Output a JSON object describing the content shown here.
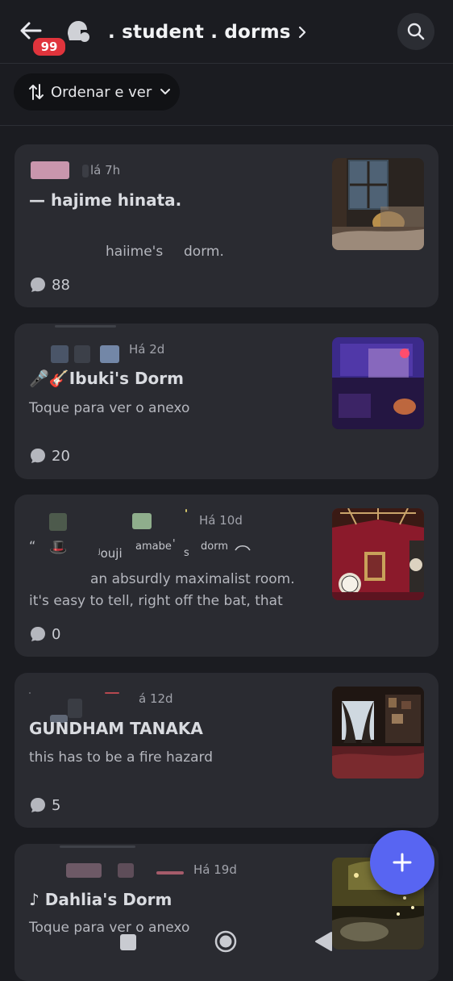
{
  "header": {
    "badge_count": "99",
    "title": ". student . dorms",
    "icons": {
      "back": "arrow-left-icon",
      "channel": "forum-channel-icon",
      "title_chevron": "chevron-right-icon",
      "search": "search-icon"
    }
  },
  "sort": {
    "label": "Ordenar e ver",
    "icons": {
      "sort": "sort-arrows-icon",
      "caret": "chevron-down-icon"
    }
  },
  "posts": [
    {
      "time": "lá 7h",
      "title": "— hajime hinata.",
      "preview_a": "haiime's",
      "preview_b": "dorm.",
      "count": "88"
    },
    {
      "time": "Há 2d",
      "title": "🎤🎸Ibuki's Dorm",
      "preview": "Toque para ver o anexo",
      "count": "20"
    },
    {
      "time": "Há 10d",
      "title_parts": [
        "“",
        "🎩",
        "ʲouji",
        "amabe",
        "'",
        "s",
        "dorm"
      ],
      "preview_a": "an absurdly maximalist room.",
      "preview_b": "it's easy to tell, right off the bat, that",
      "count": "0"
    },
    {
      "time": "á 12d",
      "title": "GUNDHAM TANAKA",
      "preview": "this has to be a fire hazard",
      "count": "5"
    },
    {
      "time": "Há 19d",
      "title": "♪ Dahlia's Dorm",
      "preview": "Toque para ver o anexo"
    }
  ],
  "fab": {
    "icon": "plus-icon"
  },
  "system_nav": {
    "icons": [
      "recents-square-icon",
      "home-circle-icon",
      "back-triangle-icon"
    ]
  },
  "colors": {
    "background": "#1b1c21",
    "card": "#2a2b31",
    "accent": "#5865f2",
    "badge": "#e0343c"
  }
}
